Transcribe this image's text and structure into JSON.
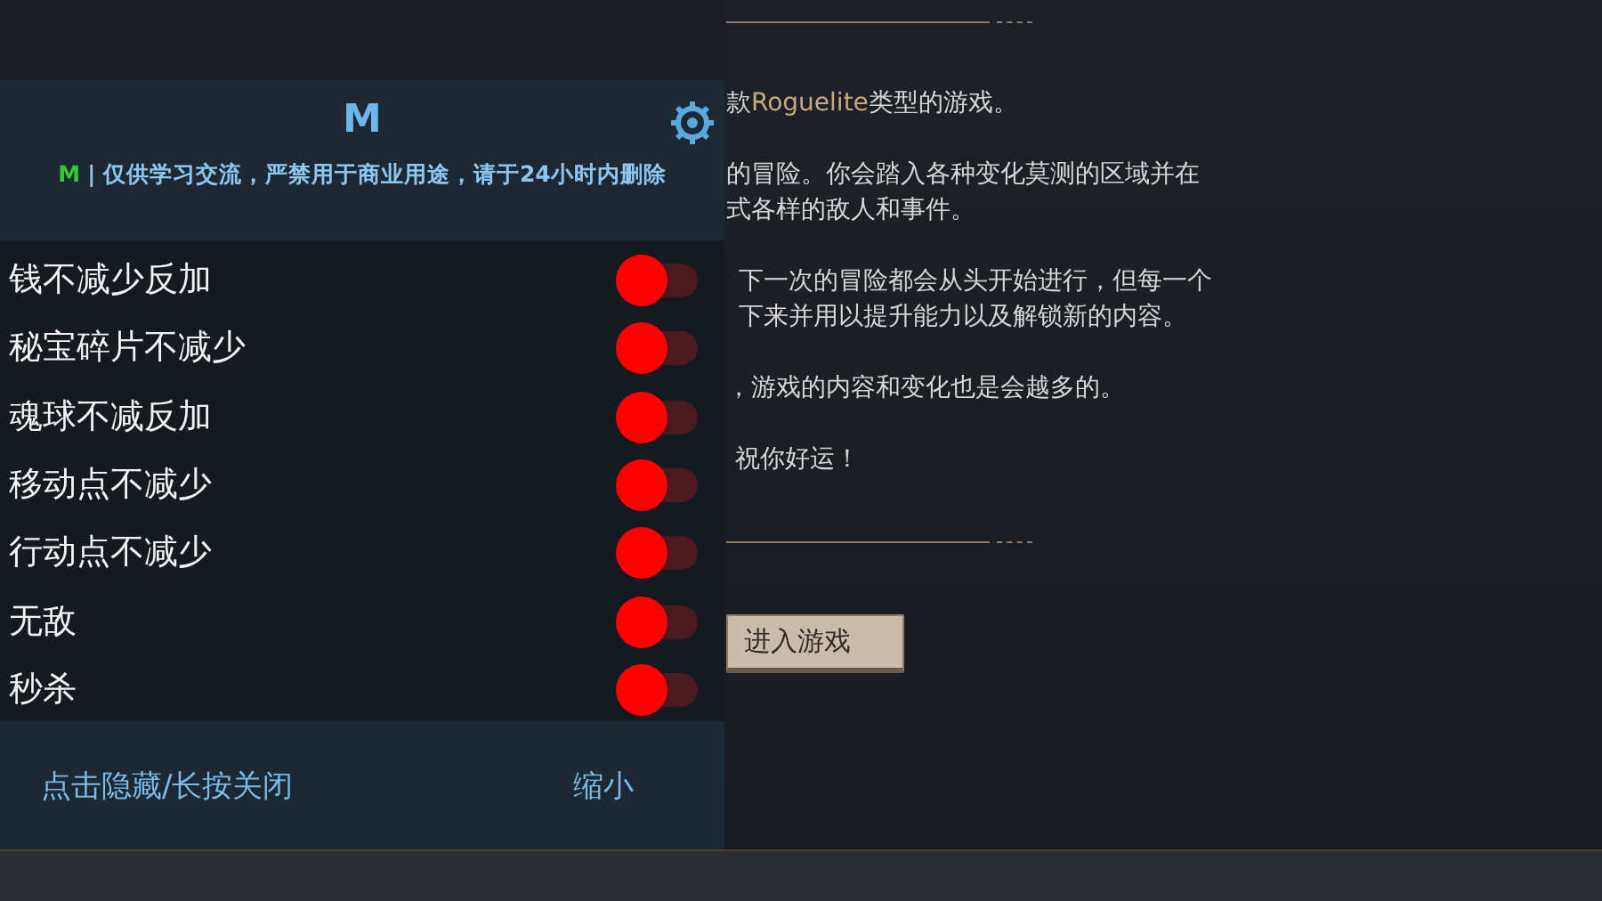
{
  "menu": {
    "title": "M",
    "notice": {
      "badge": "M",
      "text": "| 仅供学习交流，严禁用于商业用途，请于24小时内删除"
    },
    "toggles": [
      {
        "label": "钱不减少反加",
        "on": false
      },
      {
        "label": "秘宝碎片不减少",
        "on": false
      },
      {
        "label": "魂球不减反加",
        "on": false
      },
      {
        "label": "移动点不减少",
        "on": false
      },
      {
        "label": "行动点不减少",
        "on": false
      },
      {
        "label": "无敌",
        "on": false
      },
      {
        "label": "秒杀",
        "on": false
      }
    ],
    "footer": {
      "hide": "点击隐藏/长按关闭",
      "shrink": "缩小"
    }
  },
  "intro": {
    "paragraphs": [
      {
        "lines": [
          [
            {
              "text": "款"
            },
            {
              "text": "Roguelite",
              "kind": "highlight"
            },
            {
              "text": "类型的游戏。"
            }
          ]
        ]
      },
      {
        "lines": [
          [
            {
              "text": "的冒险。你会踏入各种变化莫测的区域并在"
            }
          ],
          [
            {
              "text": "式各样的敌人和事件。"
            }
          ]
        ]
      },
      {
        "lines": [
          [
            {
              "text": "下一次的冒险都会从头开始进行，但每一个"
            }
          ],
          [
            {
              "text": "下来并用以提升能力以及解锁新的内容。"
            }
          ]
        ]
      },
      {
        "lines": [
          [
            {
              "text": "，游戏的内容和变化也是会越多的。"
            }
          ]
        ]
      },
      {
        "lines": [
          [
            {
              "text": "祝你好运！"
            }
          ]
        ]
      }
    ],
    "button": "进入游戏"
  }
}
